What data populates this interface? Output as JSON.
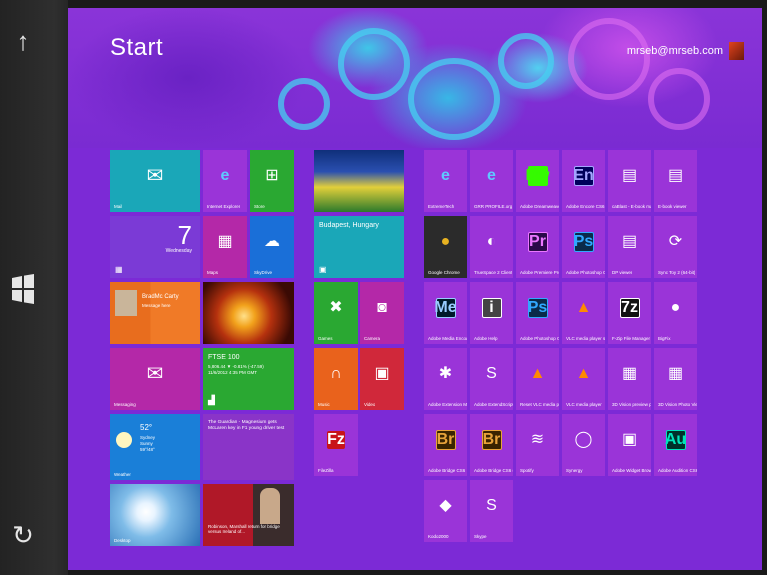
{
  "page": {
    "title": "Start",
    "user_email": "mrseb@mrseb.com"
  },
  "side": {
    "up": "↑",
    "windows": "⊞",
    "search": "↻"
  },
  "group1": {
    "mail": {
      "label": "Mail"
    },
    "ie": {
      "label": "Internet Explorer"
    },
    "store": {
      "label": "Store"
    },
    "calendar": {
      "day": "7",
      "weekday": "Wednesday"
    },
    "maps": {
      "label": "Maps"
    },
    "skydrive": {
      "label": "SkyDrive"
    },
    "people": {
      "name": "BradMc Carty",
      "sub": "Message here"
    },
    "messaging": {
      "label": "Messaging"
    },
    "finance": {
      "title": "FTSE 100",
      "line1": "5,806.44 ▼ -0.81% (-47.59)",
      "line2": "11/6/2012 4:35 PM GMT"
    },
    "weather": {
      "temp": "52°",
      "place": "Sydney",
      "desc": "Sunny",
      "range": "59°/48°",
      "label": "Weather"
    },
    "news": {
      "text": "The Guardian - Magnesium gets McLaren key in F1 young driver test"
    },
    "desktop": {
      "label": "Desktop"
    },
    "sport": {
      "text": "Robinson, Marshall return for bridge versus Ireland of..."
    }
  },
  "group2": {
    "travel": {
      "label": "Budapest, Hungary"
    },
    "games": {
      "label": "Games"
    },
    "camera": {
      "label": "Camera"
    },
    "music": {
      "label": "Music"
    },
    "video": {
      "label": "Video"
    },
    "filezilla": {
      "label": "FileZilla"
    }
  },
  "group3": {
    "tiles": [
      {
        "label": "ExtremeTech",
        "icon": "e"
      },
      {
        "label": "GRR PROFILE.org",
        "icon": "e"
      },
      {
        "label": "Adobe Dreamweaver CS6",
        "icon": "Dw"
      },
      {
        "label": "Adobe Encore CS6",
        "icon": "En"
      },
      {
        "label": "caBlast - E-book management",
        "icon": "▤"
      },
      {
        "label": "E-book viewer",
        "icon": "▤"
      },
      {
        "label": "Google Chrome",
        "icon": "●"
      },
      {
        "label": "TrueSpace 2 Client",
        "icon": "◐"
      },
      {
        "label": "Adobe Premiere Pro CS6",
        "icon": "Pr"
      },
      {
        "label": "Adobe Photoshop CS6",
        "icon": "Ps"
      },
      {
        "label": "DP viewer",
        "icon": "▤"
      },
      {
        "label": "Sync Toy 2 (64-bit)",
        "icon": "⟳"
      },
      {
        "label": "Adobe Media Encoder CS6",
        "icon": "Me"
      },
      {
        "label": "Adobe Help",
        "icon": "i"
      },
      {
        "label": "Adobe Photoshop CS6 (64 Bit)",
        "icon": "Ps"
      },
      {
        "label": "VLC media player skinned",
        "icon": "▲"
      },
      {
        "label": "F-Zip File Manager",
        "icon": "7z"
      },
      {
        "label": "BigFix",
        "icon": "●"
      },
      {
        "label": "Adobe Extension Manager CS6",
        "icon": "✱"
      },
      {
        "label": "Adobe ExtendScript",
        "icon": "S"
      },
      {
        "label": "Reset VLC media player",
        "icon": "▲"
      },
      {
        "label": "VLC media player",
        "icon": "▲"
      },
      {
        "label": "3D Vision preview part 1",
        "icon": "▦"
      },
      {
        "label": "3D Vision Photo Viewer",
        "icon": "▦"
      },
      {
        "label": "Adobe Bridge CS6",
        "icon": "Br"
      },
      {
        "label": "Adobe Bridge CS6 (64bit)",
        "icon": "Br"
      },
      {
        "label": "Spotify",
        "icon": "≋"
      },
      {
        "label": "Synergy",
        "icon": "◯"
      },
      {
        "label": "Adobe Widget Browser",
        "icon": "▣"
      },
      {
        "label": "Adobe Audition CS6",
        "icon": "Au"
      },
      {
        "label": "Kodo2000",
        "icon": "◆"
      },
      {
        "label": "Skype",
        "icon": "S"
      }
    ]
  },
  "colors": {
    "background": "#7c2ad6",
    "tile_purple": "#9a34d8",
    "tile_teal": "#1aa7b8",
    "tile_green": "#2aa832",
    "tile_blue": "#1a6fd8",
    "tile_orange": "#e9621c",
    "tile_red": "#d0283a",
    "tile_magenta": "#b428a8",
    "tile_violet": "#7b3ad6"
  }
}
